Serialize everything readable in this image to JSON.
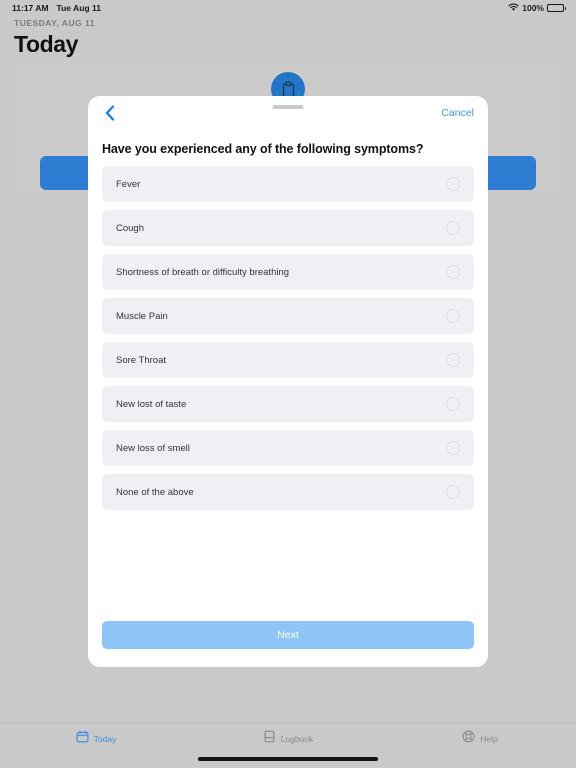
{
  "status_bar": {
    "time": "11:17 AM",
    "date": "Tue Aug 11",
    "battery_percent": "100%",
    "wifi_icon": "wifi-icon",
    "battery_icon": "battery-icon"
  },
  "header": {
    "date_label": "TUESDAY, AUG 11",
    "title": "Today"
  },
  "background_card": {
    "badge_icon": "clipboard-icon",
    "badge_color": "#2176c7",
    "action_button_color": "#2d7dd2"
  },
  "modal": {
    "back_icon": "chevron-left-icon",
    "drag_handle": "drag-handle",
    "cancel_label": "Cancel",
    "question": "Have you experienced any of the following symptoms?",
    "options": [
      {
        "label": "Fever",
        "selected": false
      },
      {
        "label": "Cough",
        "selected": false
      },
      {
        "label": "Shortness of breath or difficulty breathing",
        "selected": false
      },
      {
        "label": "Muscle Pain",
        "selected": false
      },
      {
        "label": "Sore Throat",
        "selected": false
      },
      {
        "label": "New lost of taste",
        "selected": false
      },
      {
        "label": "New loss of smell",
        "selected": false
      },
      {
        "label": "None of the above",
        "selected": false
      }
    ],
    "next_label": "Next",
    "next_button_color": "#8ec5f8",
    "accent_color": "#3d9ae8"
  },
  "tab_bar": {
    "items": [
      {
        "label": "Today",
        "icon": "calendar-icon",
        "active": true
      },
      {
        "label": "Logbook",
        "icon": "book-icon",
        "active": false
      },
      {
        "label": "Help",
        "icon": "lifebuoy-icon",
        "active": false
      }
    ],
    "active_color": "#3d8fdd",
    "inactive_color": "#8a8a8e"
  }
}
